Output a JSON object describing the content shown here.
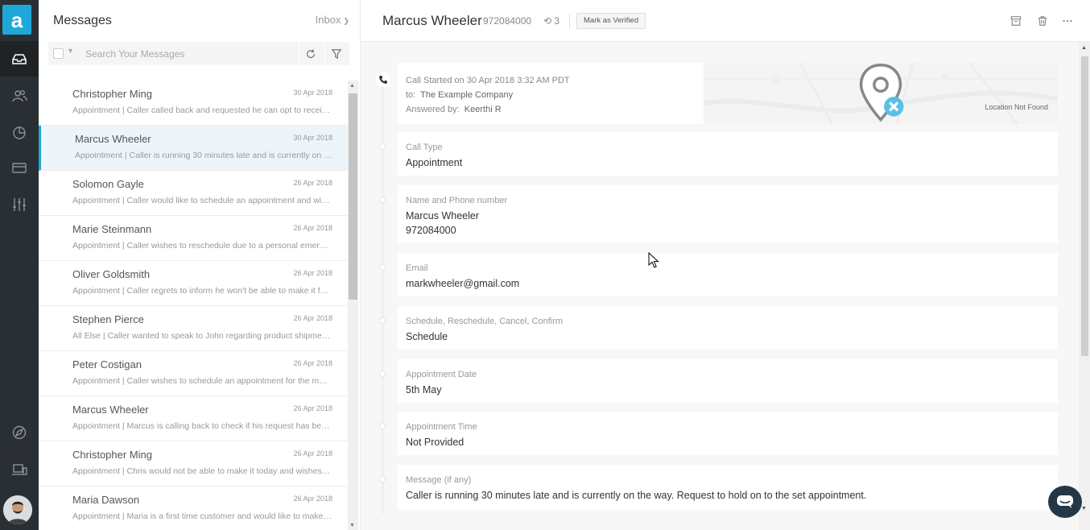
{
  "rail": {
    "logo": "a",
    "items": [
      {
        "name": "inbox",
        "icon": "inbox-icon"
      },
      {
        "name": "contacts",
        "icon": "users-icon"
      },
      {
        "name": "reports",
        "icon": "pie-chart-icon"
      },
      {
        "name": "billing",
        "icon": "card-icon"
      },
      {
        "name": "settings",
        "icon": "sliders-icon"
      },
      {
        "name": "explore",
        "icon": "compass-icon"
      },
      {
        "name": "devices",
        "icon": "devices-icon"
      }
    ]
  },
  "list": {
    "title": "Messages",
    "folder": "Inbox",
    "search_placeholder": "Search Your Messages",
    "messages": [
      {
        "name": "Christopher Ming",
        "date": "30 Apr 2018",
        "snippet": "Appointment | Caller called back and requested he can opt to receive a call back"
      },
      {
        "name": "Marcus Wheeler",
        "date": "30 Apr 2018",
        "snippet": "Appointment | Caller is running 30 minutes late and is currently on the way"
      },
      {
        "name": "Solomon Gayle",
        "date": "26 Apr 2018",
        "snippet": "Appointment | Caller would like to schedule an appointment and wishes to confirm"
      },
      {
        "name": "Marie Steinmann",
        "date": "26 Apr 2018",
        "snippet": "Appointment | Caller wishes to reschedule due to a personal emergency"
      },
      {
        "name": "Oliver Goldsmith",
        "date": "26 Apr 2018",
        "snippet": "Appointment | Caller regrets to inform he won't be able to make it for the meeting"
      },
      {
        "name": "Stephen Pierce",
        "date": "26 Apr 2018",
        "snippet": "All Else | Caller wanted to speak to John regarding product shipment details"
      },
      {
        "name": "Peter Costigan",
        "date": "26 Apr 2018",
        "snippet": "Appointment | Caller wishes to schedule an appointment for the main office"
      },
      {
        "name": "Marcus Wheeler",
        "date": "26 Apr 2018",
        "snippet": "Appointment | Marcus is calling back to check if his request has been processed"
      },
      {
        "name": "Christopher Ming",
        "date": "26 Apr 2018",
        "snippet": "Appointment | Chris would not be able to make it today and wishes to reschedule"
      },
      {
        "name": "Maria Dawson",
        "date": "26 Apr 2018",
        "snippet": "Appointment | Maria is a first time customer and would like to make an appointment"
      }
    ]
  },
  "detail": {
    "name": "Marcus Wheeler",
    "phone": "972084000",
    "history_count": "3",
    "verify_label": "Mark as Verified",
    "call": {
      "started": "Call Started on 30 Apr 2018 3:32 AM PDT",
      "to_label": "to:",
      "to_value": "The Example Company",
      "answered_label": "Answered by:",
      "answered_value": "Keerthi R",
      "location": "Location Not Found"
    },
    "fields": [
      {
        "label": "Call Type",
        "value": "Appointment"
      },
      {
        "label": "Name and Phone number",
        "value": "Marcus Wheeler\n972084000"
      },
      {
        "label": "Email",
        "value": "markwheeler@gmail.com"
      },
      {
        "label": "Schedule, Reschedule, Cancel, Confirm",
        "value": "Schedule"
      },
      {
        "label": "Appointment Date",
        "value": "5th May"
      },
      {
        "label": "Appointment Time",
        "value": "Not Provided"
      },
      {
        "label": "Message (if any)",
        "value": "Caller is running 30 minutes late and is currently on the way. Request to hold on to the set appointment."
      }
    ]
  },
  "colors": {
    "accent": "#1ea8d9",
    "rail": "#2a2f33",
    "chat": "#223846"
  }
}
